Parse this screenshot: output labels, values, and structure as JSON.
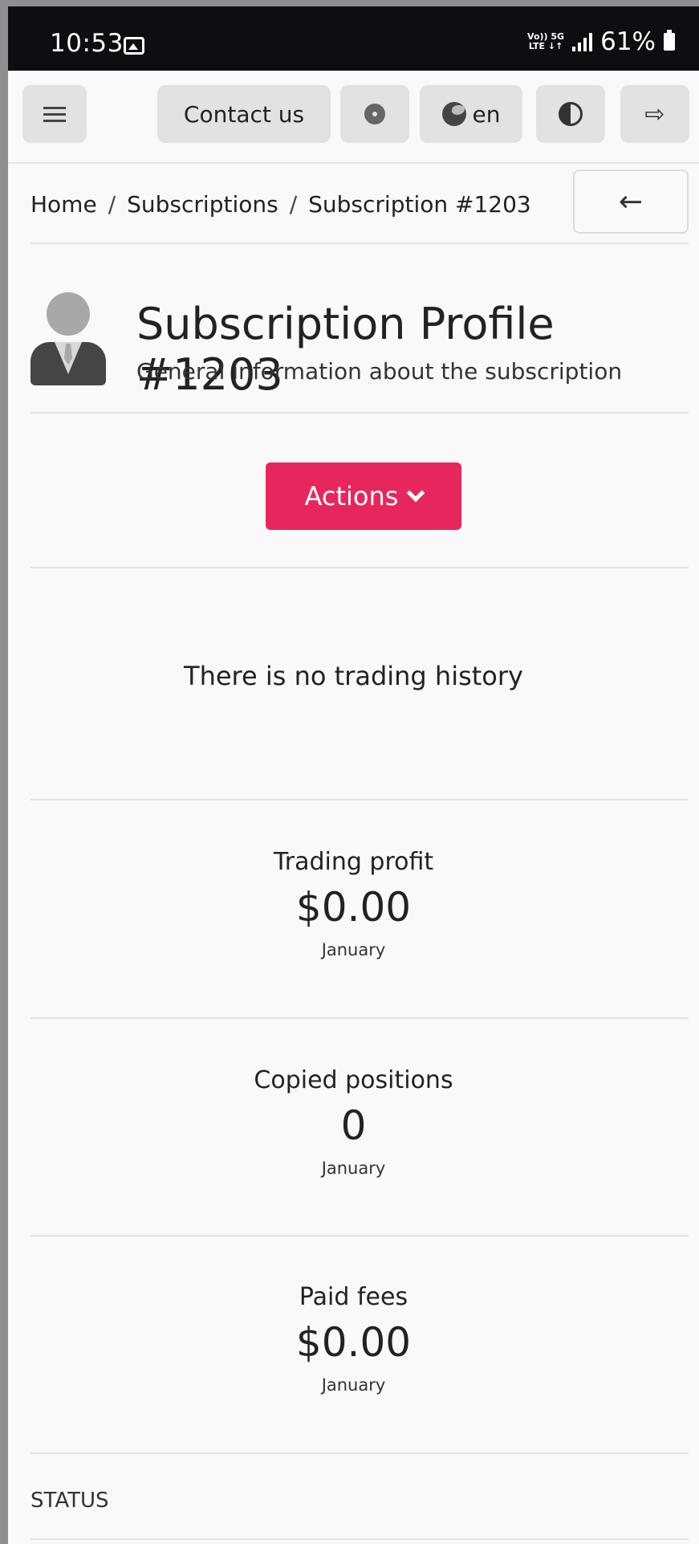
{
  "statusbar": {
    "time": "10:53",
    "network_top": "Vo)) 5G",
    "network_bottom": "LTE ↓↑",
    "battery": "61%"
  },
  "toolbar": {
    "menu_icon": "hamburger-icon",
    "contact_label": "Contact us",
    "settings_icon": "gear-icon",
    "language_icon": "globe-icon",
    "language_label": "en",
    "theme_icon": "contrast-icon",
    "logout_icon": "logout-icon"
  },
  "breadcrumb": {
    "items": [
      "Home",
      "Subscriptions",
      "Subscription #1203"
    ],
    "separator": "/",
    "back_icon": "arrow-left-icon"
  },
  "profile": {
    "title": "Subscription Profile #1203",
    "subtitle": "General information about the subscription",
    "avatar_icon": "user-avatar-icon"
  },
  "actions": {
    "label": "Actions",
    "accent_color": "#e8265e"
  },
  "history": {
    "empty_text": "There is no trading history"
  },
  "stats": [
    {
      "label": "Trading profit",
      "value": "$0.00",
      "period": "January"
    },
    {
      "label": "Copied positions",
      "value": "0",
      "period": "January"
    },
    {
      "label": "Paid fees",
      "value": "$0.00",
      "period": "January"
    }
  ],
  "status": {
    "label": "STATUS"
  }
}
